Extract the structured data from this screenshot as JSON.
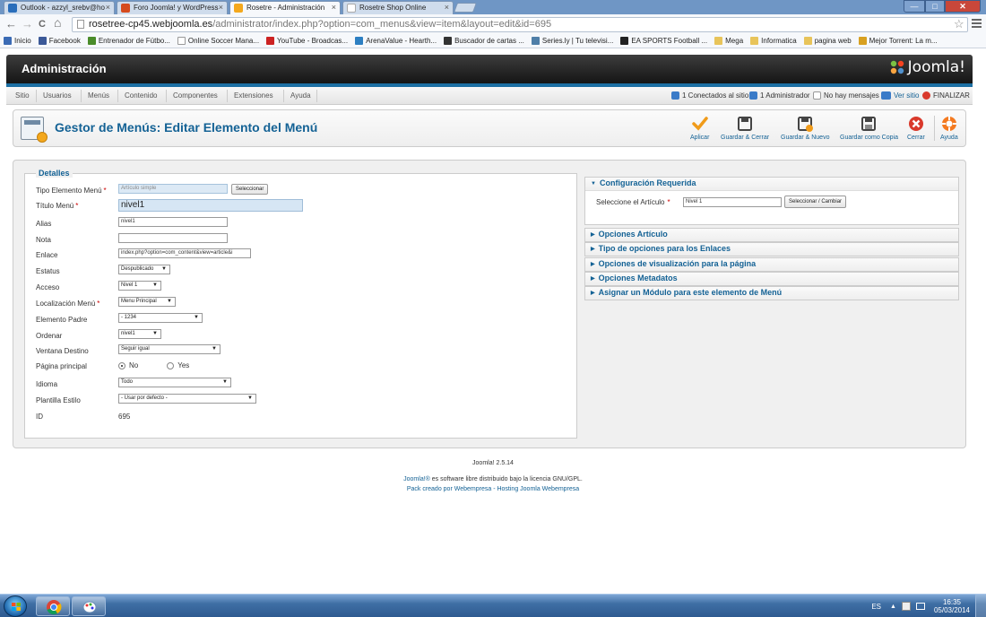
{
  "browser": {
    "tabs": [
      {
        "label": "Outlook - azzyl_srebv@ho",
        "active": false
      },
      {
        "label": "Foro Joomla! y WordPress",
        "active": false
      },
      {
        "label": "Rosetre - Administración",
        "active": true
      },
      {
        "label": "Rosetre Shop Online",
        "active": false
      }
    ],
    "tab_close": "×",
    "url_domain": "rosetree-cp45.webjoomla.es",
    "url_path": "/administrator/index.php?option=com_menus&view=item&layout=edit&id=695",
    "back": "←",
    "forward": "→",
    "reload": "C",
    "home": "⌂",
    "star": "☆",
    "window_controls": {
      "minimize": "—",
      "maximize": "□",
      "close": "✕"
    },
    "bookmarks": [
      {
        "label": "Inicio",
        "color": "#3b6bb5"
      },
      {
        "label": "Facebook",
        "color": "#3b5998"
      },
      {
        "label": "Entrenador de Fútbo...",
        "color": "#4a8c2a"
      },
      {
        "label": "Online Soccer Mana...",
        "color": "#ffffff"
      },
      {
        "label": "YouTube - Broadcas...",
        "color": "#cc2222"
      },
      {
        "label": "ArenaValue - Hearth...",
        "color": "#2c7fc2"
      },
      {
        "label": "Buscador de cartas ...",
        "color": "#333333"
      },
      {
        "label": "Series.ly | Tu televisi...",
        "color": "#4f7fa8"
      },
      {
        "label": "EA SPORTS Football ...",
        "color": "#222222"
      },
      {
        "label": "Mega",
        "color": "#e8c45a"
      },
      {
        "label": "Informatica",
        "color": "#e8c45a"
      },
      {
        "label": "pagina web",
        "color": "#e8c45a"
      },
      {
        "label": "Mejor Torrent: La m...",
        "color": "#d8a020"
      }
    ]
  },
  "admin": {
    "title": "Administración",
    "logo_text": "Joomla!",
    "menu": [
      "Sitio",
      "Usuarios",
      "Menús",
      "Contenido",
      "Componentes",
      "Extensiones",
      "Ayuda"
    ],
    "status": {
      "connected": "1 Conectados al sitio",
      "admins": "1 Administrador",
      "messages": "No hay mensajes",
      "view_site": "Ver sitio",
      "logout": "FINALIZAR"
    },
    "page_title": "Gestor de Menús: Editar Elemento del Menú",
    "toolbar": {
      "apply": "Aplicar",
      "save_close": "Guardar & Cerrar",
      "save_new": "Guardar & Nuevo",
      "save_copy": "Guardar como Copia",
      "close": "Cerrar",
      "help": "Ayuda"
    }
  },
  "form": {
    "legend": "Detalles",
    "required_mark": "*",
    "menu_item_type": {
      "label": "Tipo Elemento Menú",
      "value": "Artículo simple",
      "button": "Seleccionar"
    },
    "menu_title": {
      "label": "Título Menú",
      "value": "nivel1"
    },
    "alias": {
      "label": "Alias",
      "value": "nivel1"
    },
    "note": {
      "label": "Nota",
      "value": ""
    },
    "link": {
      "label": "Enlace",
      "value": "index.php?option=com_content&view=article&i"
    },
    "status": {
      "label": "Estatus",
      "value": "Despublicado"
    },
    "access": {
      "label": "Acceso",
      "value": "Nivel 1"
    },
    "menu_location": {
      "label": "Localización Menú",
      "value": "Menu Principal"
    },
    "parent": {
      "label": "Elemento Padre",
      "value": "- 1234"
    },
    "ordering": {
      "label": "Ordenar",
      "value": "nivel1"
    },
    "target_window": {
      "label": "Ventana Destino",
      "value": "Seguir igual"
    },
    "home": {
      "label": "Página principal",
      "no": "No",
      "yes": "Yes",
      "selected": "No"
    },
    "language": {
      "label": "Idioma",
      "value": "Todo"
    },
    "template_style": {
      "label": "Plantilla Estilo",
      "value": "- Usar por defecto -"
    },
    "id": {
      "label": "ID",
      "value": "695"
    }
  },
  "panels": {
    "required": {
      "title": "Configuración Requerida",
      "article_label": "Seleccione el Artículo",
      "article_value": "Nivel 1",
      "article_button": "Seleccionar / Cambiar"
    },
    "collapsed": [
      "Opciones Artículo",
      "Tipo de opciones para los Enlaces",
      "Opciones de visualización para la página",
      "Opciones Metadatos",
      "Asignar un Módulo para este elemento de Menú"
    ]
  },
  "footer": {
    "version": "Joomla! 2.5.14",
    "license_link": "Joomla!®",
    "license_text": " es software libre distribuido bajo la licencia GNU/GPL.",
    "pack_prefix": "Pack creado por ",
    "pack_link1": "Webempresa",
    "pack_mid": " - ",
    "pack_link2": "Hosting Joomla Webempresa"
  },
  "taskbar": {
    "lang": "ES",
    "time": "16:35",
    "date": "05/03/2014"
  },
  "colors": {
    "joomla_blue": "#146295",
    "admin_bar": "#1f1f1f",
    "accent_strip": "#1c6fa3",
    "apply_orange": "#f09b1a",
    "close_red": "#d9392b"
  }
}
